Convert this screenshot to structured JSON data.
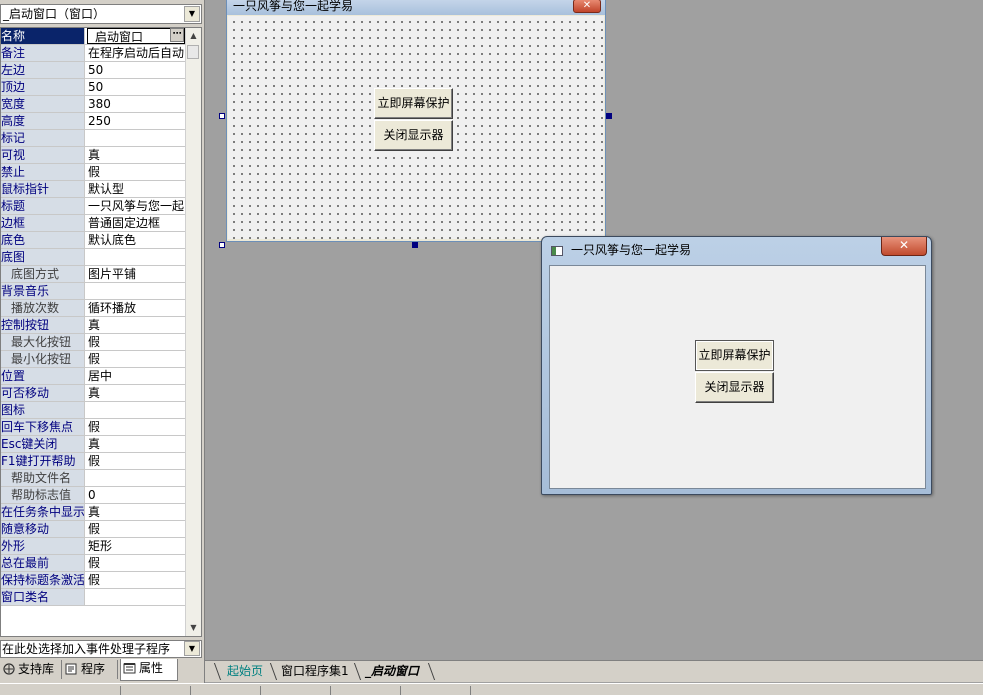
{
  "left_panel": {
    "object_selector": "_启动窗口（窗口）",
    "properties": [
      {
        "name": "名称",
        "value": "_启动窗口",
        "selected": true
      },
      {
        "name": "备注",
        "value": "在程序启动后自动"
      },
      {
        "name": "左边",
        "value": "50"
      },
      {
        "name": "顶边",
        "value": "50"
      },
      {
        "name": "宽度",
        "value": "380"
      },
      {
        "name": "高度",
        "value": "250"
      },
      {
        "name": "标记",
        "value": ""
      },
      {
        "name": "可视",
        "value": "真"
      },
      {
        "name": "禁止",
        "value": "假"
      },
      {
        "name": "鼠标指针",
        "value": "默认型"
      },
      {
        "name": "标题",
        "value": "一只风筝与您一起"
      },
      {
        "name": "边框",
        "value": "普通固定边框"
      },
      {
        "name": "底色",
        "value": "默认底色"
      },
      {
        "name": "底图",
        "value": ""
      },
      {
        "name": "底图方式",
        "value": "图片平铺",
        "indent": true
      },
      {
        "name": "背景音乐",
        "value": ""
      },
      {
        "name": "播放次数",
        "value": "循环播放",
        "indent": true
      },
      {
        "name": "控制按钮",
        "value": "真"
      },
      {
        "name": "最大化按钮",
        "value": "假",
        "indent": true
      },
      {
        "name": "最小化按钮",
        "value": "假",
        "indent": true
      },
      {
        "name": "位置",
        "value": "居中"
      },
      {
        "name": "可否移动",
        "value": "真"
      },
      {
        "name": "图标",
        "value": ""
      },
      {
        "name": "回车下移焦点",
        "value": "假"
      },
      {
        "name": "Esc键关闭",
        "value": "真"
      },
      {
        "name": "F1键打开帮助",
        "value": "假"
      },
      {
        "name": "帮助文件名",
        "value": "",
        "indent": true
      },
      {
        "name": "帮助标志值",
        "value": "0",
        "indent": true
      },
      {
        "name": "在任务条中显示",
        "value": "真"
      },
      {
        "name": "随意移动",
        "value": "假"
      },
      {
        "name": "外形",
        "value": "矩形"
      },
      {
        "name": "总在最前",
        "value": "假"
      },
      {
        "name": "保持标题条激活",
        "value": "假"
      },
      {
        "name": "窗口类名",
        "value": ""
      }
    ],
    "event_selector": "在此处选择加入事件处理子程序",
    "tabs": [
      {
        "label": "支持库",
        "icon": "library-icon"
      },
      {
        "label": "程序",
        "icon": "program-icon"
      },
      {
        "label": "属性",
        "icon": "properties-icon",
        "active": true
      }
    ]
  },
  "design_form": {
    "title": "一只风筝与您一起学易",
    "buttons": [
      "立即屏幕保护",
      "关闭显示器"
    ]
  },
  "preview_window": {
    "title": "一只风筝与您一起学易",
    "close_glyph": "✕",
    "buttons": [
      "立即屏幕保护",
      "关闭显示器"
    ]
  },
  "editor_tabs": [
    {
      "label": "起始页",
      "style": "link"
    },
    {
      "label": "窗口程序集1",
      "style": "normal"
    },
    {
      "label": "_启动窗口",
      "style": "active"
    }
  ],
  "colors": {
    "selected_row": "#0a246a",
    "property_name_bg": "#d6dde6",
    "property_name_text": "#00007f",
    "workspace_bg": "#a0a0a0"
  }
}
